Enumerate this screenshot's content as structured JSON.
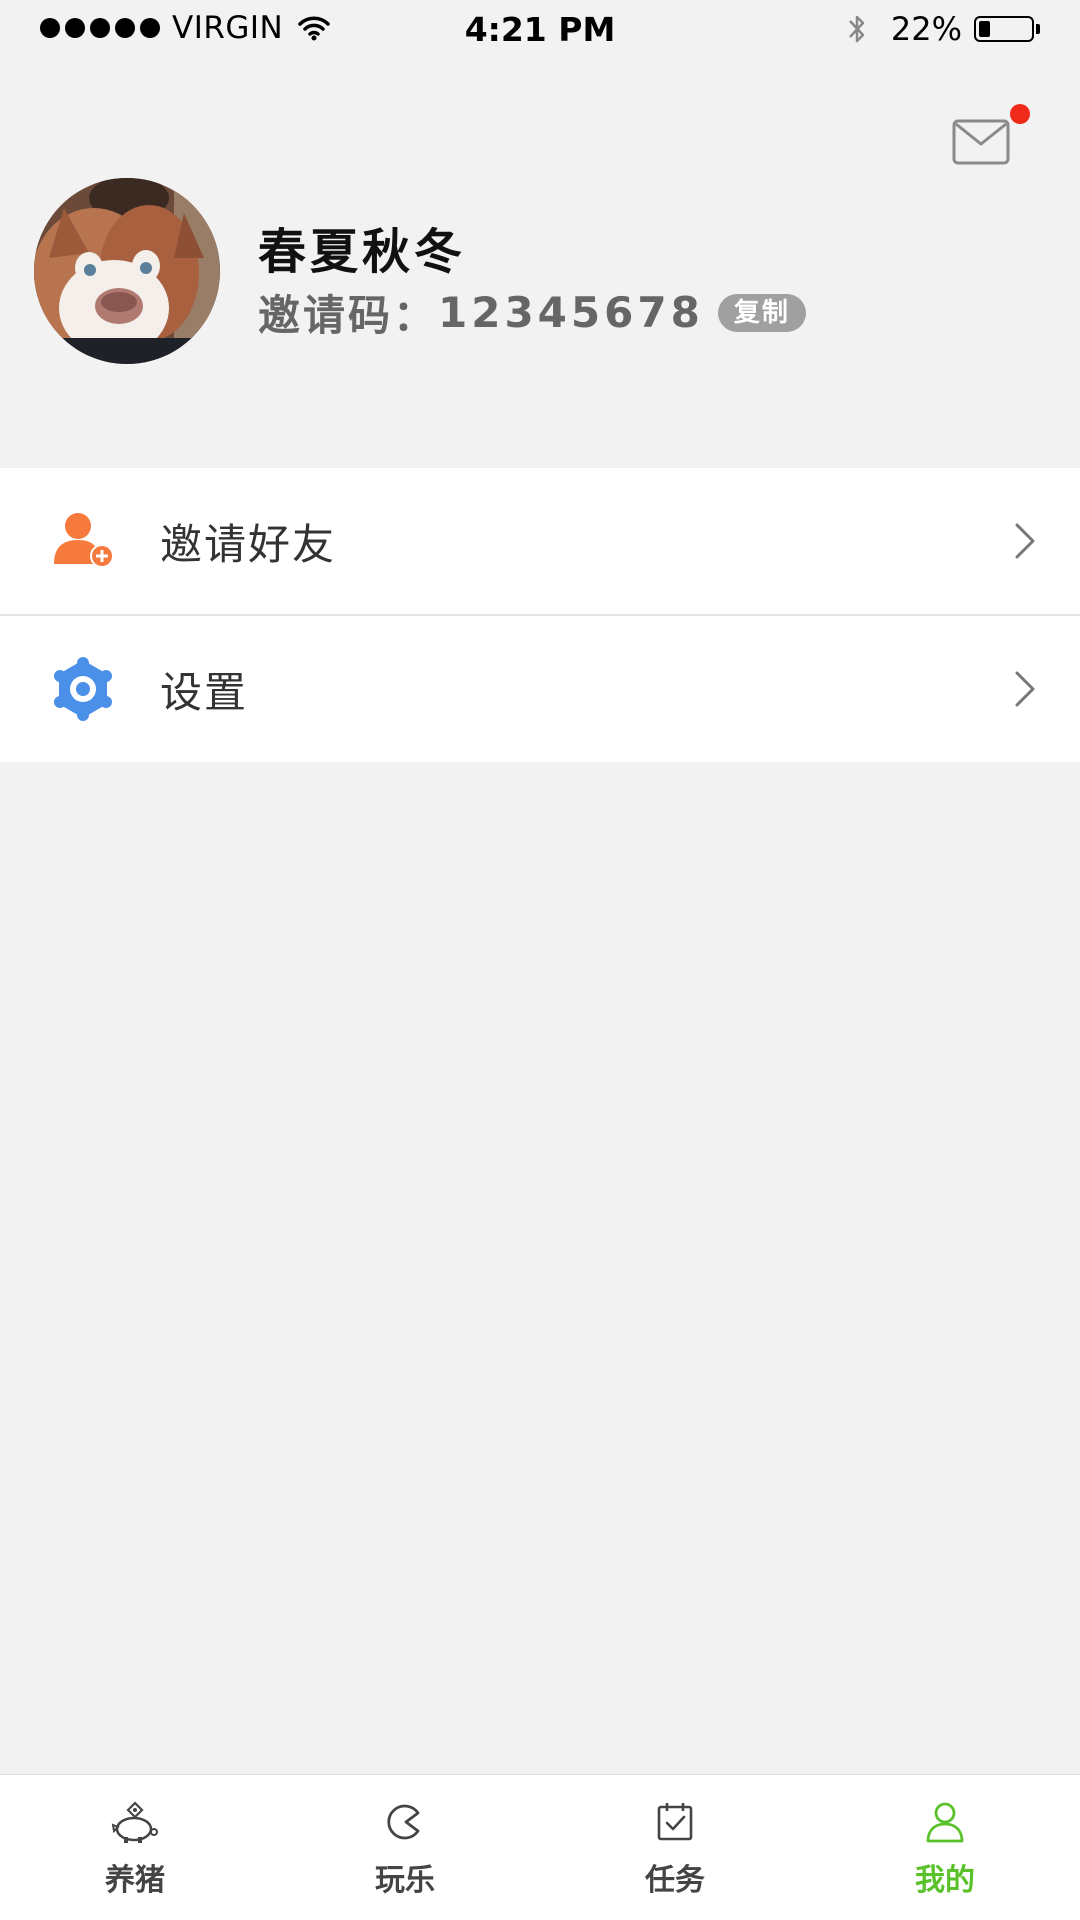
{
  "status_bar": {
    "carrier": "VIRGIN",
    "time": "4:21 PM",
    "battery_percent": "22%",
    "battery_level": 0.22,
    "icons": [
      "signal-dots-icon",
      "wifi-icon",
      "bluetooth-icon",
      "battery-icon"
    ]
  },
  "header": {
    "mail_icon": "mail-icon",
    "has_unread": true,
    "unread_color": "#f02a1a",
    "nickname": "春夏秋冬",
    "invite_label": "邀请码：",
    "invite_code": "12345678",
    "copy_label": "复制",
    "avatar": "avatar-image"
  },
  "menu": {
    "items": [
      {
        "label": "邀请好友",
        "icon": "add-user-icon",
        "icon_color": "#f57a3c"
      },
      {
        "label": "设置",
        "icon": "gear-icon",
        "icon_color": "#4a90e8"
      }
    ]
  },
  "tab_bar": {
    "active_color": "#5ac12b",
    "tabs": [
      {
        "label": "养猪",
        "icon": "piggy-bank-icon",
        "active": false
      },
      {
        "label": "玩乐",
        "icon": "play-icon",
        "active": false
      },
      {
        "label": "任务",
        "icon": "calendar-check-icon",
        "active": false
      },
      {
        "label": "我的",
        "icon": "user-icon",
        "active": true
      }
    ]
  }
}
